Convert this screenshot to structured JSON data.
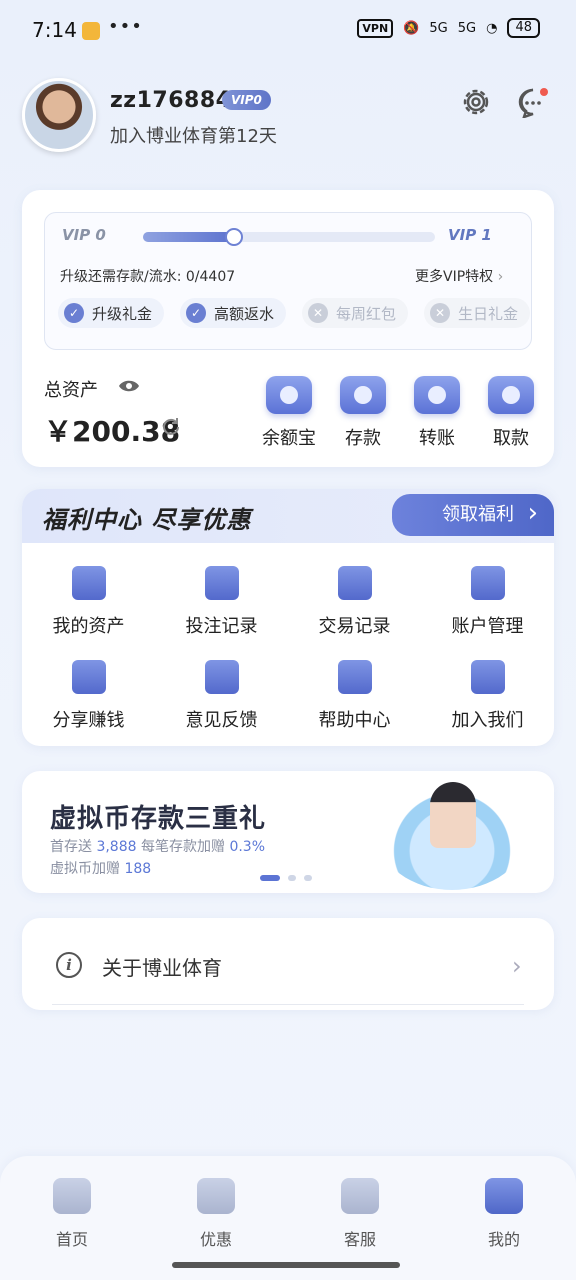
{
  "status_bar": {
    "time": "7:14",
    "dots": "•••",
    "vpn": "VPN",
    "net1": "5G",
    "net2": "5G",
    "battery": "48"
  },
  "profile": {
    "username": "zz176884",
    "vip_badge": "VIP0",
    "joined": "加入博业体育第12天"
  },
  "vip_card": {
    "from_level": "VIP 0",
    "to_level": "VIP 1",
    "progress": 0.31,
    "upgrade_text": "升级还需存款/流水: 0/4407",
    "more_link": "更多VIP特权",
    "perks": [
      {
        "label": "升级礼金",
        "enabled": true
      },
      {
        "label": "高额返水",
        "enabled": true
      },
      {
        "label": "每周红包",
        "enabled": false
      },
      {
        "label": "生日礼金",
        "enabled": false
      }
    ]
  },
  "assets": {
    "label": "总资产",
    "amount": "￥200.38"
  },
  "actions": [
    {
      "label": "余额宝"
    },
    {
      "label": "存款"
    },
    {
      "label": "转账"
    },
    {
      "label": "取款"
    }
  ],
  "welfare": {
    "title": "福利中心 尽享优惠",
    "claim_button": "领取福利",
    "items": [
      {
        "label": "我的资产"
      },
      {
        "label": "投注记录"
      },
      {
        "label": "交易记录"
      },
      {
        "label": "账户管理"
      },
      {
        "label": "分享赚钱"
      },
      {
        "label": "意见反馈"
      },
      {
        "label": "帮助中心"
      },
      {
        "label": "加入我们"
      }
    ]
  },
  "banner": {
    "title": "虚拟币存款三重礼",
    "line1_a": "首存送",
    "line1_b": "3,888",
    "line1_c": "每笔存款加赠",
    "line1_d": "0.3%",
    "line2_a": "虚拟币加赠",
    "line2_b": "188"
  },
  "about": {
    "label": "关于博业体育"
  },
  "nav": [
    {
      "label": "首页"
    },
    {
      "label": "优惠"
    },
    {
      "label": "客服"
    },
    {
      "label": "我的"
    }
  ],
  "colors": {
    "accent": "#5b72d6",
    "accent_dark": "#4f67c8",
    "background": "#eef3fc"
  }
}
